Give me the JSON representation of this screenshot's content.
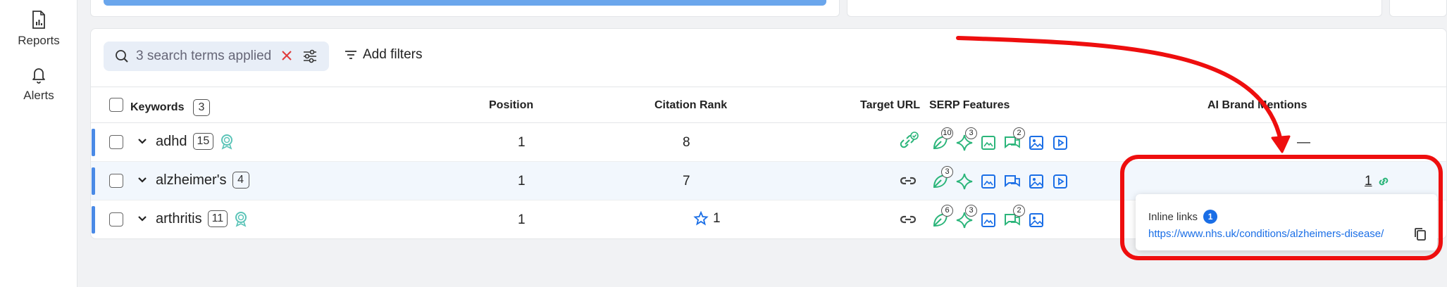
{
  "sidebar": {
    "items": [
      {
        "label": "Reports",
        "icon": "report-icon"
      },
      {
        "label": "Alerts",
        "icon": "bell-icon"
      }
    ]
  },
  "filters": {
    "search_placeholder": "3 search terms applied",
    "add_filters_label": "Add filters"
  },
  "table": {
    "headers": {
      "keywords": "Keywords",
      "keywords_count": "3",
      "position": "Position",
      "citation_rank": "Citation Rank",
      "target_url": "Target URL",
      "serp_features": "SERP Features",
      "ai_brand_mentions": "AI Brand Mentions"
    },
    "rows": [
      {
        "keyword": "adhd",
        "count": "15",
        "position": "1",
        "citation_rank": "8",
        "ai_mentions": "—"
      },
      {
        "keyword": "alzheimer's",
        "count": "4",
        "position": "1",
        "citation_rank": "7",
        "ai_mentions": "1"
      },
      {
        "keyword": "arthritis",
        "count": "11",
        "position": "1",
        "citation_rank": "1",
        "ai_mentions": ""
      }
    ],
    "serp_counts": {
      "adhd": [
        "10",
        "3",
        "2"
      ],
      "alzheimers": [
        "3"
      ],
      "arthritis": [
        "6",
        "3",
        "2"
      ]
    }
  },
  "popover": {
    "title": "Inline links",
    "count": "1",
    "url": "https://www.nhs.uk/conditions/alzheimers-disease/"
  },
  "colors": {
    "accent": "#4a8ae6",
    "serp_green": "#2bb57a",
    "link_blue": "#1a6ee6",
    "annotation_red": "#ee0e0e"
  }
}
